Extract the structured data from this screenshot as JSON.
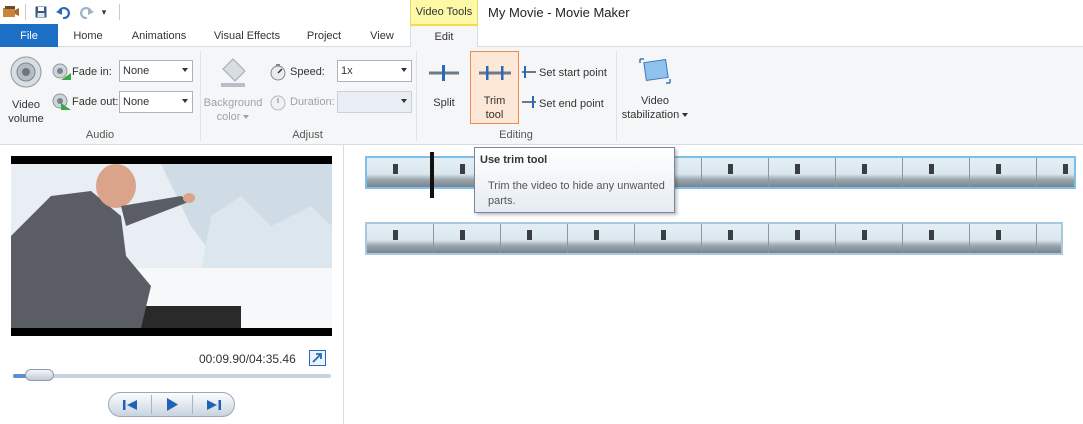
{
  "window": {
    "title": "My Movie - Movie Maker",
    "context_tab_group": "Video Tools"
  },
  "tabs": {
    "file": "File",
    "home": "Home",
    "animations": "Animations",
    "visual_effects": "Visual Effects",
    "project": "Project",
    "view": "View",
    "edit": "Edit"
  },
  "ribbon": {
    "audio": {
      "group_label": "Audio",
      "video_volume_line1": "Video",
      "video_volume_line2": "volume",
      "fade_in_label": "Fade in:",
      "fade_in_value": "None",
      "fade_out_label": "Fade out:",
      "fade_out_value": "None"
    },
    "adjust": {
      "group_label": "Adjust",
      "background_color_line1": "Background",
      "background_color_line2": "color",
      "speed_label": "Speed:",
      "speed_value": "1x",
      "duration_label": "Duration:"
    },
    "editing": {
      "group_label": "Editing",
      "split": "Split",
      "trim_line1": "Trim",
      "trim_line2": "tool",
      "set_start": "Set start point",
      "set_end": "Set end point"
    },
    "stabilization": {
      "line1": "Video",
      "line2": "stabilization"
    }
  },
  "preview": {
    "time": "00:09.90/04:35.46",
    "seek_position": 0.05
  },
  "tooltip": {
    "title": "Use trim tool",
    "body": "Trim the video to hide any unwanted parts."
  },
  "colors": {
    "file_tab": "#1d6fc5",
    "context_tab": "#fef9a6",
    "selection_border": "#7cbfe8",
    "highlight": "#f08a4b"
  }
}
